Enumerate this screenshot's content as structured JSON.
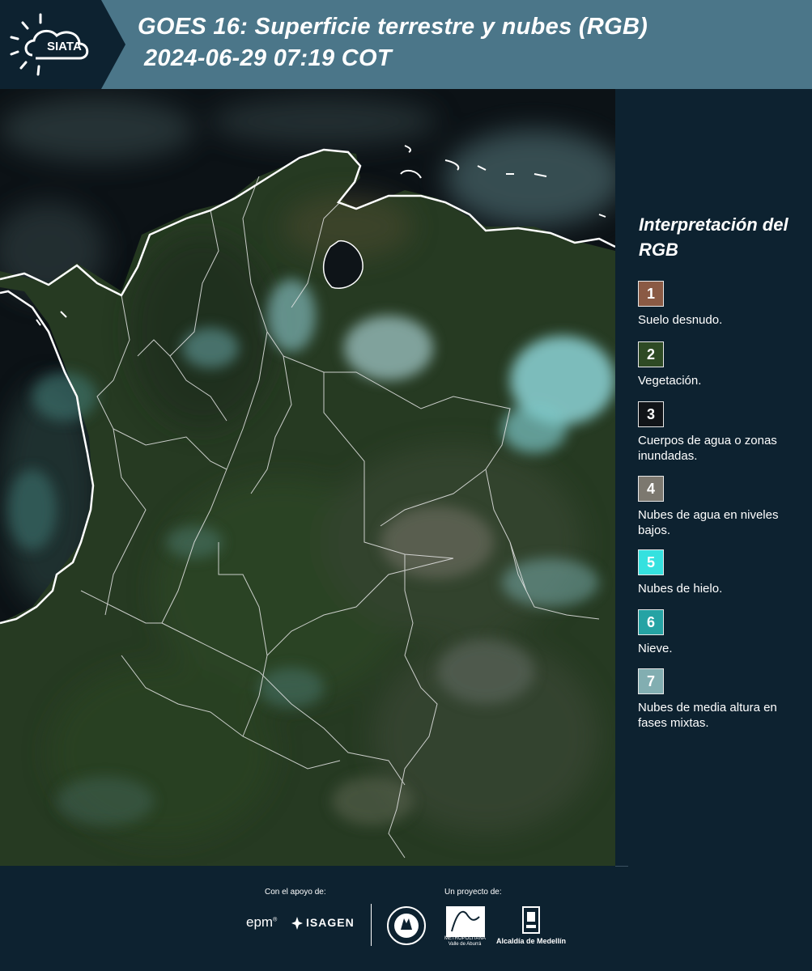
{
  "header": {
    "logo_text": "SIATA",
    "title_line1": "GOES 16: Superficie terrestre y nubes (RGB)",
    "title_line2": "2024-06-29 07:19 COT"
  },
  "legend": {
    "title": "Interpretación del RGB",
    "items": [
      {
        "number": "1",
        "label": "Suelo desnudo.",
        "color": "#8a5a44"
      },
      {
        "number": "2",
        "label": "Vegetación.",
        "color": "#2e4a24"
      },
      {
        "number": "3",
        "label": "Cuerpos de agua o zonas inundadas.",
        "color": "#111418"
      },
      {
        "number": "4",
        "label": "Nubes de agua en niveles bajos.",
        "color": "#7c786f"
      },
      {
        "number": "5",
        "label": "Nubes de hielo.",
        "color": "#35e1df"
      },
      {
        "number": "6",
        "label": "Nieve.",
        "color": "#25a3a4"
      },
      {
        "number": "7",
        "label": "Nubes de media altura en fases mixtas.",
        "color": "#82aeb1"
      }
    ]
  },
  "footer": {
    "support_label": "Con el apoyo de:",
    "project_label": "Un proyecto de:",
    "sponsor_epm": "epm",
    "sponsor_isagen": "ISAGEN",
    "metropolitana_text": "METROPOLITANA Valle de Aburrá",
    "alcaldia_text": "Alcaldía de Medellín"
  },
  "colors": {
    "header_bg": "#4b7689",
    "logo_bg": "#0d2230",
    "panel_bg": "#0d2230",
    "land": "#263a22",
    "ocean": "#0c1216",
    "cloud": "#5fb3b6"
  }
}
